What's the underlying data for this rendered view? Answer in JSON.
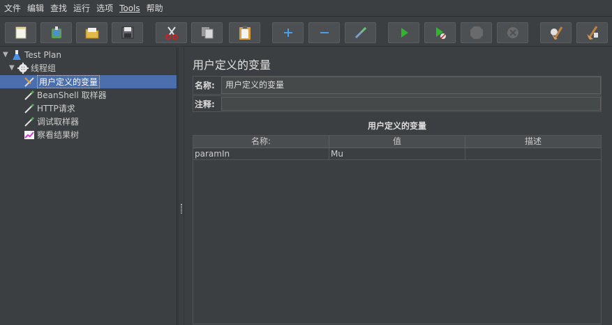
{
  "menubar": {
    "items": [
      "文件",
      "编辑",
      "查找",
      "运行",
      "选项",
      "Tools",
      "帮助"
    ]
  },
  "toolbar": {
    "buttons": [
      {
        "name": "new",
        "icon": "new-file-icon"
      },
      {
        "name": "templates",
        "icon": "templates-icon"
      },
      {
        "name": "open",
        "icon": "open-folder-icon"
      },
      {
        "name": "save",
        "icon": "save-disk-icon"
      },
      {
        "name": "cut",
        "icon": "scissors-icon"
      },
      {
        "name": "copy",
        "icon": "copy-icon"
      },
      {
        "name": "paste",
        "icon": "clipboard-icon"
      },
      {
        "name": "expand",
        "icon": "plus-icon"
      },
      {
        "name": "collapse",
        "icon": "minus-icon"
      },
      {
        "name": "toggle",
        "icon": "wand-icon"
      },
      {
        "name": "start",
        "icon": "play-icon"
      },
      {
        "name": "start-no-pause",
        "icon": "play-no-timer-icon"
      },
      {
        "name": "stop",
        "icon": "stop-icon"
      },
      {
        "name": "shutdown",
        "icon": "shutdown-icon"
      },
      {
        "name": "clear",
        "icon": "broom-icon"
      },
      {
        "name": "clear-all",
        "icon": "broom-all-icon"
      }
    ]
  },
  "tree": {
    "items": [
      {
        "label": "Test Plan",
        "icon": "flask-icon",
        "expanded": true
      },
      {
        "label": "线程组",
        "icon": "gear-icon",
        "expanded": true
      },
      {
        "label": "用户定义的变量",
        "icon": "wrench-icon",
        "selected": true
      },
      {
        "label": "BeanShell 取样器",
        "icon": "pipette-icon"
      },
      {
        "label": "HTTP请求",
        "icon": "pipette-icon"
      },
      {
        "label": "调试取样器",
        "icon": "pipette-icon"
      },
      {
        "label": "察看结果树",
        "icon": "chart-icon"
      }
    ]
  },
  "main": {
    "title": "用户定义的变量",
    "name_label": "名称:",
    "name_value": "用户定义的变量",
    "comment_label": "注释:",
    "comment_value": "",
    "table_caption": "用户定义的变量",
    "columns": [
      "名称:",
      "值",
      "描述"
    ],
    "rows": [
      [
        "paramIn",
        "Mu",
        ""
      ]
    ]
  },
  "colors": {
    "background": "#3c3f41",
    "selection": "#4b6eaf",
    "play_green": "#2fb52f"
  }
}
